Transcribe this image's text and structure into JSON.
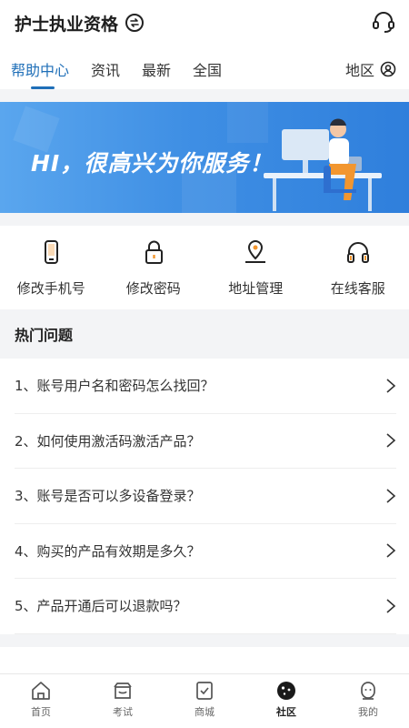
{
  "header": {
    "title": "护士执业资格"
  },
  "tabs": [
    "帮助中心",
    "资讯",
    "最新",
    "全国"
  ],
  "region": {
    "label": "地区"
  },
  "banner": {
    "text": "HI，很高兴为你服务！"
  },
  "quick_actions": [
    {
      "label": "修改手机号",
      "icon": "phone-icon"
    },
    {
      "label": "修改密码",
      "icon": "lock-icon"
    },
    {
      "label": "地址管理",
      "icon": "location-icon"
    },
    {
      "label": "在线客服",
      "icon": "headset-icon"
    }
  ],
  "hot": {
    "title": "热门问题",
    "questions": [
      "1、账号用户名和密码怎么找回？",
      "2、如何使用激活码激活产品？",
      "3、账号是否可以多设备登录？",
      "4、购买的产品有效期是多久？",
      "5、产品开通后可以退款吗？"
    ]
  },
  "bottom_nav": [
    {
      "label": "首页",
      "icon": "home-icon"
    },
    {
      "label": "考试",
      "icon": "exam-icon"
    },
    {
      "label": "商城",
      "icon": "shop-icon"
    },
    {
      "label": "社区",
      "icon": "community-icon",
      "active": true
    },
    {
      "label": "我的",
      "icon": "profile-icon"
    }
  ],
  "colors": {
    "accent": "#1f6fb8",
    "banner": "#3f8fe4",
    "orange": "#f2962f"
  }
}
